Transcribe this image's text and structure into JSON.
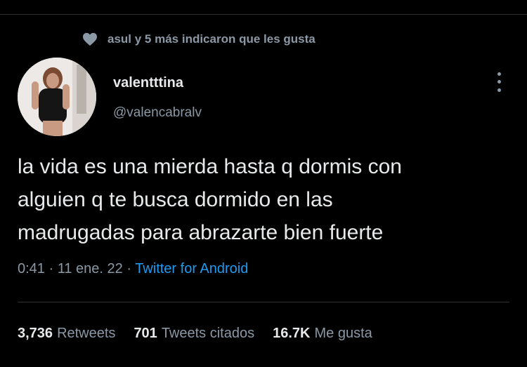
{
  "social_context": {
    "icon": "heart-icon",
    "text": "asul y 5 más indicaron que les gusta"
  },
  "author": {
    "name": "valentttina",
    "handle": "@valencabralv",
    "avatar": "avatar-photo"
  },
  "tweet": {
    "text": "la vida es una mierda hasta q dormis con\nalguien q te busca dormido en las\nmadrugadas para abrazarte bien fuerte",
    "time": "0:41",
    "date": "11 ene. 22",
    "source": "Twitter for Android",
    "separator": " · "
  },
  "stats": {
    "retweets_count": "3,736",
    "retweets_label": "Retweets",
    "quotes_count": "701",
    "quotes_label": "Tweets citados",
    "likes_count": "16.7K",
    "likes_label": "Me gusta"
  },
  "colors": {
    "background": "#000000",
    "text": "#e7e9ea",
    "secondary": "#8b98a5",
    "link": "#1d9bf0"
  }
}
